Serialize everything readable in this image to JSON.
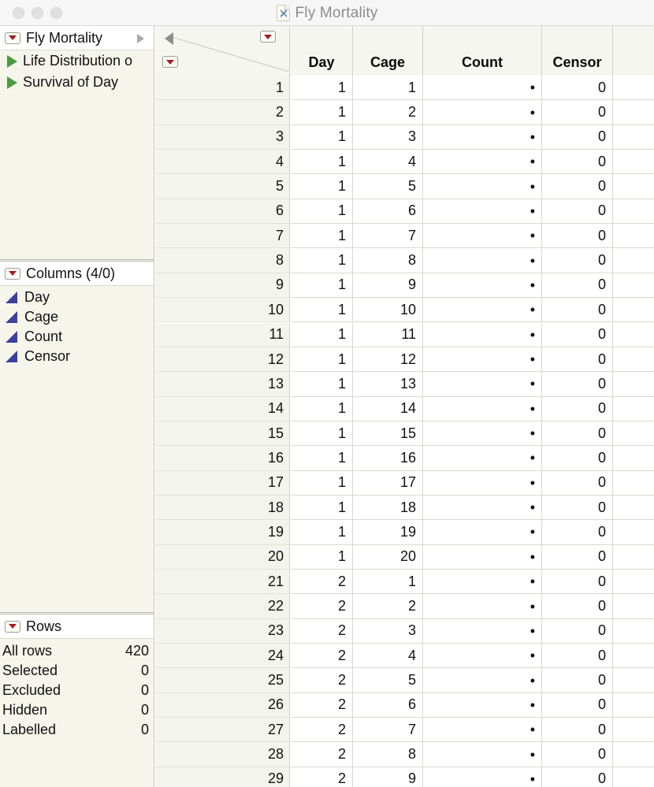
{
  "window": {
    "title": "Fly Mortality",
    "doc_icon": "jmp-data-table-icon",
    "traffic_lights": [
      "close-button",
      "minimize-button",
      "zoom-button"
    ]
  },
  "sidebar": {
    "tree": {
      "menu_icon": "red-triangle-menu-icon",
      "items": [
        {
          "label": "Fly Mortality",
          "icon": "red-triangle-menu-icon",
          "selected": true,
          "disclosure": "gray-right-triangle-icon"
        },
        {
          "label": "Life Distribution o",
          "icon": "green-play-triangle-icon",
          "selected": false
        },
        {
          "label": "Survival of Day",
          "icon": "green-play-triangle-icon",
          "selected": false
        }
      ]
    },
    "columns_panel": {
      "title": "Columns (4/0)",
      "menu_icon": "red-triangle-menu-icon",
      "items": [
        {
          "label": "Day",
          "icon": "continuous-blue-triangle-icon"
        },
        {
          "label": "Cage",
          "icon": "continuous-blue-triangle-icon"
        },
        {
          "label": "Count",
          "icon": "continuous-blue-triangle-icon"
        },
        {
          "label": "Censor",
          "icon": "continuous-blue-triangle-icon"
        }
      ]
    },
    "rows_panel": {
      "title": "Rows",
      "menu_icon": "red-triangle-menu-icon",
      "stats": [
        {
          "label": "All rows",
          "value": "420"
        },
        {
          "label": "Selected",
          "value": "0"
        },
        {
          "label": "Excluded",
          "value": "0"
        },
        {
          "label": "Hidden",
          "value": "0"
        },
        {
          "label": "Labelled",
          "value": "0"
        }
      ]
    }
  },
  "table": {
    "corner": {
      "collapse_icon": "gray-left-triangle-icon",
      "top_menu_icon": "red-triangle-menu-icon",
      "bottom_menu_icon": "red-triangle-menu-icon"
    },
    "columns": [
      "Day",
      "Cage",
      "Count",
      "Censor",
      ""
    ],
    "rows": [
      {
        "n": "1",
        "Day": "1",
        "Cage": "1",
        "Count": "•",
        "Censor": "0"
      },
      {
        "n": "2",
        "Day": "1",
        "Cage": "2",
        "Count": "•",
        "Censor": "0"
      },
      {
        "n": "3",
        "Day": "1",
        "Cage": "3",
        "Count": "•",
        "Censor": "0"
      },
      {
        "n": "4",
        "Day": "1",
        "Cage": "4",
        "Count": "•",
        "Censor": "0"
      },
      {
        "n": "5",
        "Day": "1",
        "Cage": "5",
        "Count": "•",
        "Censor": "0"
      },
      {
        "n": "6",
        "Day": "1",
        "Cage": "6",
        "Count": "•",
        "Censor": "0"
      },
      {
        "n": "7",
        "Day": "1",
        "Cage": "7",
        "Count": "•",
        "Censor": "0"
      },
      {
        "n": "8",
        "Day": "1",
        "Cage": "8",
        "Count": "•",
        "Censor": "0"
      },
      {
        "n": "9",
        "Day": "1",
        "Cage": "9",
        "Count": "•",
        "Censor": "0"
      },
      {
        "n": "10",
        "Day": "1",
        "Cage": "10",
        "Count": "•",
        "Censor": "0"
      },
      {
        "n": "11",
        "Day": "1",
        "Cage": "11",
        "Count": "•",
        "Censor": "0"
      },
      {
        "n": "12",
        "Day": "1",
        "Cage": "12",
        "Count": "•",
        "Censor": "0"
      },
      {
        "n": "13",
        "Day": "1",
        "Cage": "13",
        "Count": "•",
        "Censor": "0"
      },
      {
        "n": "14",
        "Day": "1",
        "Cage": "14",
        "Count": "•",
        "Censor": "0"
      },
      {
        "n": "15",
        "Day": "1",
        "Cage": "15",
        "Count": "•",
        "Censor": "0"
      },
      {
        "n": "16",
        "Day": "1",
        "Cage": "16",
        "Count": "•",
        "Censor": "0"
      },
      {
        "n": "17",
        "Day": "1",
        "Cage": "17",
        "Count": "•",
        "Censor": "0"
      },
      {
        "n": "18",
        "Day": "1",
        "Cage": "18",
        "Count": "•",
        "Censor": "0"
      },
      {
        "n": "19",
        "Day": "1",
        "Cage": "19",
        "Count": "•",
        "Censor": "0"
      },
      {
        "n": "20",
        "Day": "1",
        "Cage": "20",
        "Count": "•",
        "Censor": "0"
      },
      {
        "n": "21",
        "Day": "2",
        "Cage": "1",
        "Count": "•",
        "Censor": "0"
      },
      {
        "n": "22",
        "Day": "2",
        "Cage": "2",
        "Count": "•",
        "Censor": "0"
      },
      {
        "n": "23",
        "Day": "2",
        "Cage": "3",
        "Count": "•",
        "Censor": "0"
      },
      {
        "n": "24",
        "Day": "2",
        "Cage": "4",
        "Count": "•",
        "Censor": "0"
      },
      {
        "n": "25",
        "Day": "2",
        "Cage": "5",
        "Count": "•",
        "Censor": "0"
      },
      {
        "n": "26",
        "Day": "2",
        "Cage": "6",
        "Count": "•",
        "Censor": "0"
      },
      {
        "n": "27",
        "Day": "2",
        "Cage": "7",
        "Count": "•",
        "Censor": "0"
      },
      {
        "n": "28",
        "Day": "2",
        "Cage": "8",
        "Count": "•",
        "Censor": "0"
      },
      {
        "n": "29",
        "Day": "2",
        "Cage": "9",
        "Count": "•",
        "Censor": "0"
      }
    ]
  },
  "colors": {
    "menu_red": "#a61c20",
    "continuous_blue": "#3b3f9e",
    "script_green": "#4b9b42",
    "panel_bg": "#f5f5ec",
    "header_bg": "#f6f6f0"
  }
}
